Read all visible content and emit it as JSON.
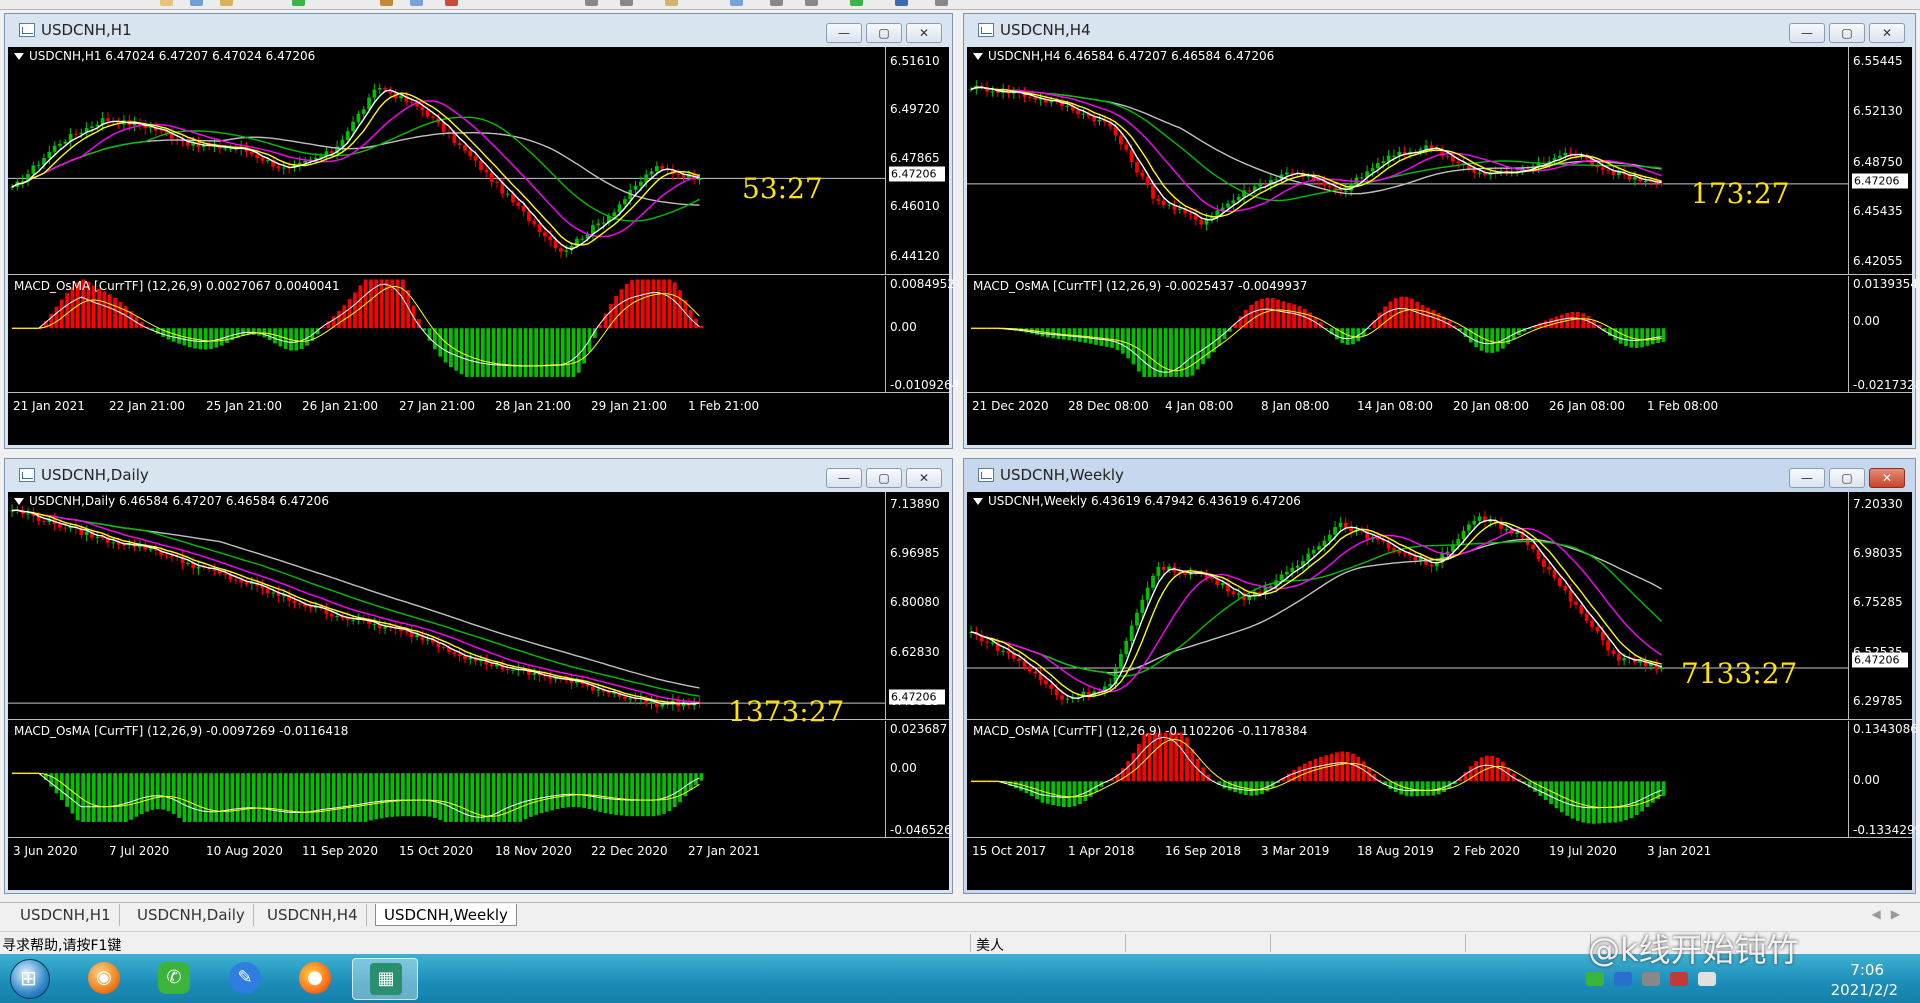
{
  "app": {
    "tabs": [
      {
        "label": "USDCNH,H1"
      },
      {
        "label": "USDCNH,Daily"
      },
      {
        "label": "USDCNH,H4"
      },
      {
        "label": "USDCNH,Weekly"
      }
    ],
    "active_tab": 3
  },
  "status_bar": {
    "help": "寻求帮助,请按F1键",
    "profile": "美人"
  },
  "taskbar": {
    "apps": [
      {
        "icon": "explorer-globe-icon"
      },
      {
        "icon": "wechat-icon"
      },
      {
        "icon": "notes-icon"
      },
      {
        "icon": "firefox-icon"
      },
      {
        "icon": "metatrader-icon"
      }
    ],
    "time": "7:06",
    "date": "2021/2/2",
    "watermark": "@k线开始钝竹"
  },
  "colors": {
    "chart_bg": "#000000",
    "bull_candle": "#00c000",
    "bear_candle": "#ff0000",
    "ma_white": "#ffffff",
    "ma_yellow": "#ffff00",
    "ma_magenta": "#ff00ff",
    "ma_green": "#00c000",
    "ma_gray": "#c0c0c0",
    "countdown": "#ffe200"
  },
  "charts": [
    {
      "title": "USDCNH,H1",
      "ohlc": "USDCNH,H1  6.47024 6.47207 6.47024 6.47206",
      "price_ticks": [
        "6.51610",
        "6.49720",
        "6.47865",
        "6.46010",
        "6.44120"
      ],
      "current_price": "6.47206",
      "macd_label": "MACD_OsMA [CurrTF] (12,26,9) 0.0027067 0.0040041",
      "macd_ticks": [
        "0.0084952",
        "0.00",
        "-0.0109264"
      ],
      "dates": [
        "21 Jan 2021",
        "22 Jan 21:00",
        "25 Jan 21:00",
        "26 Jan 21:00",
        "27 Jan 21:00",
        "28 Jan 21:00",
        "29 Jan 21:00",
        "1 Feb 21:00"
      ],
      "countdown": "53:27"
    },
    {
      "title": "USDCNH,H4",
      "ohlc": "USDCNH,H4  6.46584 6.47207 6.46584 6.47206",
      "price_ticks": [
        "6.55445",
        "6.52130",
        "6.48750",
        "6.45435",
        "6.42055"
      ],
      "current_price": "6.47206",
      "macd_label": "MACD_OsMA [CurrTF] (12,26,9) -0.0025437 -0.0049937",
      "macd_ticks": [
        "0.0139354",
        "0.00",
        "-0.0217328"
      ],
      "dates": [
        "21 Dec 2020",
        "28 Dec 08:00",
        "4 Jan 08:00",
        "8 Jan 08:00",
        "14 Jan 08:00",
        "20 Jan 08:00",
        "26 Jan 08:00",
        "1 Feb 08:00"
      ],
      "countdown": "173:27"
    },
    {
      "title": "USDCNH,Daily",
      "ohlc": "USDCNH,Daily  6.46584 6.47207 6.46584 6.47206",
      "price_ticks": [
        "7.13890",
        "6.96985",
        "6.80080",
        "6.62830",
        "6.45925"
      ],
      "current_price": "6.47206",
      "macd_label": "MACD_OsMA [CurrTF] (12,26,9) -0.0097269 -0.0116418",
      "macd_ticks": [
        "0.023687",
        "0.00",
        "-0.046526"
      ],
      "dates": [
        "3 Jun 2020",
        "7 Jul 2020",
        "10 Aug 2020",
        "11 Sep 2020",
        "15 Oct 2020",
        "18 Nov 2020",
        "22 Dec 2020",
        "27 Jan 2021"
      ],
      "countdown": "1373:27"
    },
    {
      "title": "USDCNH,Weekly",
      "ohlc": "USDCNH,Weekly  6.43619 6.47942 6.43619 6.47206",
      "price_ticks": [
        "7.20330",
        "6.98035",
        "6.75285",
        "6.52535",
        "6.29785"
      ],
      "current_price": "6.47206",
      "macd_label": "MACD_OsMA [CurrTF] (12,26,9) -0.1102206 -0.1178384",
      "macd_ticks": [
        "0.1343086",
        "0.00",
        "-0.1334299"
      ],
      "dates": [
        "15 Oct 2017",
        "1 Apr 2018",
        "16 Sep 2018",
        "3 Mar 2019",
        "18 Aug 2019",
        "2 Feb 2020",
        "19 Jul 2020",
        "3 Jan 2021"
      ],
      "countdown": "7133:27"
    }
  ],
  "chart_data": [
    {
      "type": "line",
      "title": "USDCNH,H1",
      "x": [
        "21 Jan 2021",
        "22 Jan 21:00",
        "25 Jan 21:00",
        "26 Jan 21:00",
        "27 Jan 21:00",
        "28 Jan 21:00",
        "29 Jan 21:00",
        "1 Feb 21:00"
      ],
      "y_ticks": [
        6.5161,
        6.4972,
        6.47865,
        6.4601,
        6.4412
      ],
      "ylim": [
        6.4412,
        6.5161
      ],
      "close_path": [
        6.468,
        6.485,
        6.494,
        6.491,
        6.484,
        6.483,
        6.475,
        6.482,
        6.506,
        6.497,
        6.48,
        6.462,
        6.445,
        6.458,
        6.476,
        6.472
      ],
      "last_close": 6.47206
    },
    {
      "type": "line",
      "title": "USDCNH,H4",
      "x": [
        "21 Dec 2020",
        "28 Dec 08:00",
        "4 Jan 08:00",
        "8 Jan 08:00",
        "14 Jan 08:00",
        "20 Jan 08:00",
        "26 Jan 08:00",
        "1 Feb 08:00"
      ],
      "y_ticks": [
        6.55445,
        6.5213,
        6.4875,
        6.45435,
        6.42055
      ],
      "ylim": [
        6.42055,
        6.55445
      ],
      "close_path": [
        6.536,
        6.532,
        6.524,
        6.511,
        6.462,
        6.447,
        6.468,
        6.481,
        6.466,
        6.489,
        6.497,
        6.478,
        6.481,
        6.493,
        6.479,
        6.472
      ],
      "last_close": 6.47206
    },
    {
      "type": "line",
      "title": "USDCNH,Daily",
      "x": [
        "3 Jun 2020",
        "7 Jul 2020",
        "10 Aug 2020",
        "11 Sep 2020",
        "15 Oct 2020",
        "18 Nov 2020",
        "22 Dec 2020",
        "27 Jan 2021"
      ],
      "y_ticks": [
        7.1389,
        6.96985,
        6.8008,
        6.6283,
        6.45925
      ],
      "ylim": [
        6.45925,
        7.1389
      ],
      "close_path": [
        7.12,
        7.07,
        7.02,
        6.99,
        6.93,
        6.88,
        6.82,
        6.77,
        6.73,
        6.69,
        6.62,
        6.58,
        6.55,
        6.51,
        6.47,
        6.472
      ],
      "last_close": 6.47206
    },
    {
      "type": "line",
      "title": "USDCNH,Weekly",
      "x": [
        "15 Oct 2017",
        "1 Apr 2018",
        "16 Sep 2018",
        "3 Mar 2019",
        "18 Aug 2019",
        "2 Feb 2020",
        "19 Jul 2020",
        "3 Jan 2021"
      ],
      "y_ticks": [
        7.2033,
        6.98035,
        6.75285,
        6.52535,
        6.29785
      ],
      "ylim": [
        6.29785,
        7.2033
      ],
      "close_path": [
        6.63,
        6.51,
        6.33,
        6.39,
        6.92,
        6.89,
        6.78,
        6.91,
        7.12,
        7.02,
        6.93,
        7.14,
        7.06,
        6.78,
        6.52,
        6.472
      ],
      "last_close": 6.47206
    }
  ]
}
